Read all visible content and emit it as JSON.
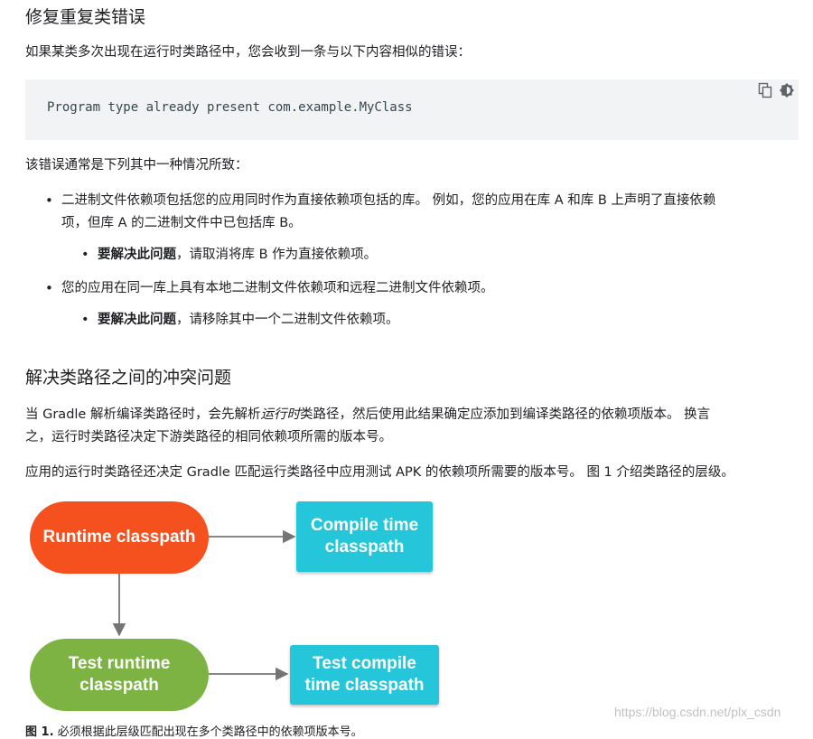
{
  "section1": {
    "heading": "修复重复类错误",
    "intro": "如果某类多次出现在运行时类路径中，您会收到一条与以下内容相似的错误：",
    "code": "Program type already present com.example.MyClass",
    "causes_intro": "该错误通常是下列其中一种情况所致：",
    "bullets": [
      {
        "text_line1": "二进制文件依赖项包括您的应用同时作为直接依赖项包括的库。 例如，您的应用在库 A 和库 B 上声明了直接依赖",
        "text_line2": "项，但库 A 的二进制文件中已包括库 B。",
        "fix_bold": "要解决此问题",
        "fix_text": "，请取消将库 B 作为直接依赖项。"
      },
      {
        "text_line1": "您的应用在同一库上具有本地二进制文件依赖项和远程二进制文件依赖项。",
        "fix_bold": "要解决此问题",
        "fix_text": "，请移除其中一个二进制文件依赖项。"
      }
    ]
  },
  "section2": {
    "heading": "解决类路径之间的冲突问题",
    "para1_a": "当 Gradle 解析编译类路径时，会先解析",
    "para1_em": "运行时",
    "para1_b": "类路径，然后使用此结果确定应添加到编译类路径的依赖项版本。 换言",
    "para1_line2": "之，运行时类路径决定下游类路径的相同依赖项所需的版本号。",
    "para2": "应用的运行时类路径还决定 Gradle 匹配运行类路径中应用测试 APK 的依赖项所需要的版本号。 图 1 介绍类路径的层级。"
  },
  "diagram": {
    "nodes": {
      "runtime": {
        "label": "Runtime classpath",
        "color": "#f4511e"
      },
      "compile": {
        "line1": "Compile time",
        "line2": "classpath",
        "color": "#26c6da"
      },
      "test_runtime": {
        "line1": "Test runtime",
        "line2": "classpath",
        "color": "#7cb342"
      },
      "test_compile": {
        "line1": "Test compile",
        "line2": "time classpath",
        "color": "#26c6da"
      }
    }
  },
  "caption": {
    "bold": "图 1.",
    "text": " 必须根据此层级匹配出现在多个类路径中的依赖项版本号。"
  },
  "watermark": "https://blog.csdn.net/plx_csdn"
}
